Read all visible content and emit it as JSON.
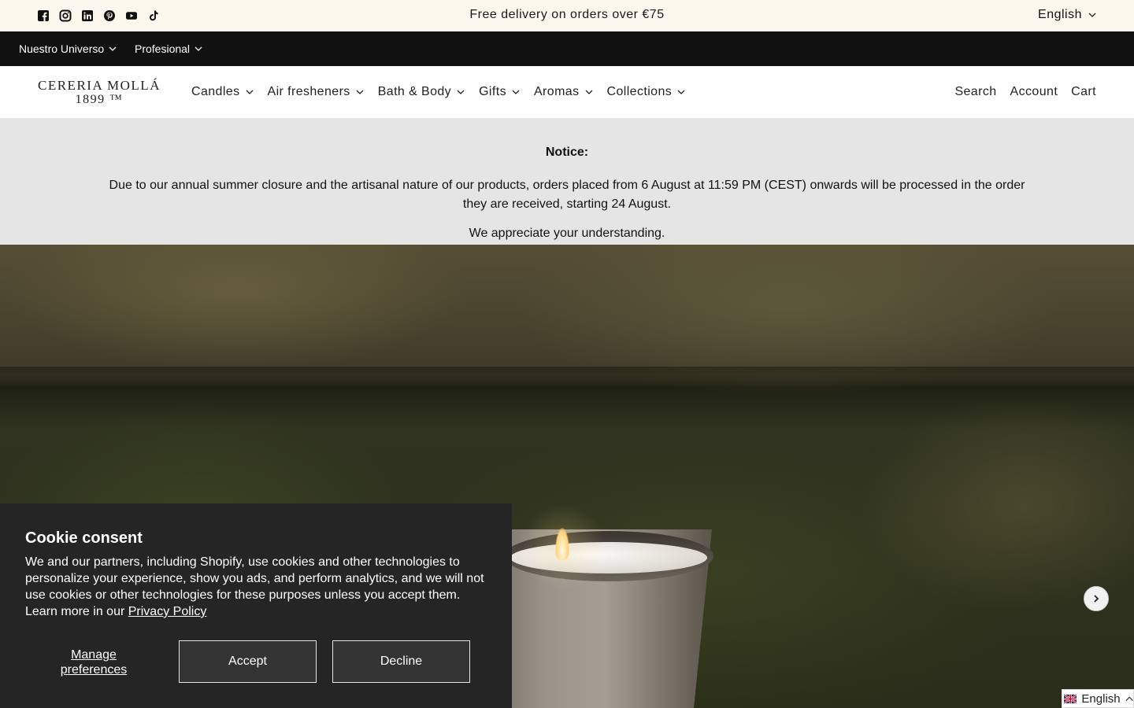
{
  "announcement": {
    "text": "Free delivery on orders over €75",
    "language": "English",
    "socials": [
      "facebook-icon",
      "instagram-icon",
      "linkedin-icon",
      "pinterest-icon",
      "youtube-icon",
      "tiktok-icon"
    ]
  },
  "topnav": {
    "items": [
      {
        "label": "Nuestro Universo"
      },
      {
        "label": "Profesional"
      }
    ]
  },
  "header": {
    "logo_line1": "CERERIA MOLLÁ",
    "logo_line2": "1899 ™",
    "nav": [
      {
        "label": "Candles"
      },
      {
        "label": "Air fresheners"
      },
      {
        "label": "Bath & Body"
      },
      {
        "label": "Gifts"
      },
      {
        "label": "Aromas"
      },
      {
        "label": "Collections"
      }
    ],
    "search": "Search",
    "account": "Account",
    "cart": "Cart"
  },
  "notice": {
    "title": "Notice:",
    "body": "Due to our annual summer closure and the artisanal nature of our products, orders placed from 6 August at 11:59 PM (CEST) onwards will be processed in the order they are received, starting 24 August.",
    "thanks": "We appreciate your understanding."
  },
  "cookie": {
    "title": "Cookie consent",
    "text": "We and our partners, including Shopify, use cookies and other technologies to personalize your experience, show you ads, and perform analytics, and we will not use cookies or other technologies for these purposes unless you accept them. Learn more in our",
    "link": "Privacy Policy",
    "manage": "Manage preferences",
    "accept": "Accept",
    "decline": "Decline"
  },
  "language_widget": {
    "label": "English"
  },
  "colors": {
    "announce_bg": "#fdf8ee",
    "topnav_bg": "#111111",
    "notice_bg": "#e5e5e5",
    "cookie_bg": "#252525"
  }
}
